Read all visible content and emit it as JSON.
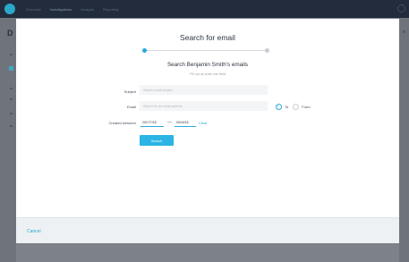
{
  "app": {
    "nav": [
      "Overview",
      "Investigations",
      "Analysis",
      "Reporting"
    ],
    "page_initial": "D"
  },
  "modal": {
    "title": "Search for email",
    "subtitle": "Search Benjamin Smith's emails",
    "hint": "Fill out at least one field",
    "subject": {
      "label": "Subject",
      "placeholder": "Search email subject",
      "value": ""
    },
    "email": {
      "label": "Email",
      "placeholder": "Search for an email address",
      "value": "",
      "direction_options": [
        "To",
        "From"
      ],
      "selected_direction": "To"
    },
    "created_between": {
      "label": "Created between",
      "from": "2017/7/18",
      "separator": "—",
      "to": "09/16/16",
      "clear_label": "Clear"
    },
    "search_button": "Search",
    "cancel_label": "Cancel",
    "stepper": {
      "current": 1,
      "total": 2
    }
  },
  "colors": {
    "accent": "#2aa8df",
    "button": "#2cb4e4",
    "topbar": "#222c3c",
    "overlay": "#7d8189"
  },
  "icons": {
    "logo": "logo-icon",
    "settings": "gear-icon"
  }
}
